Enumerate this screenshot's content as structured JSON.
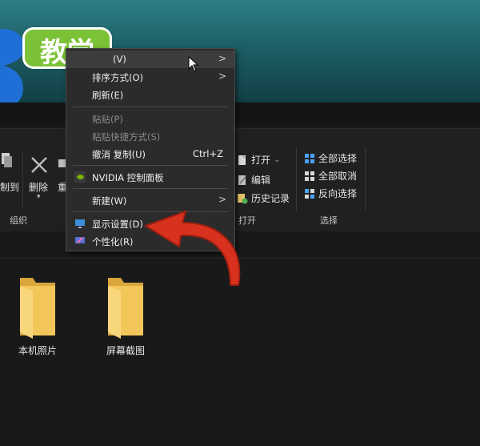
{
  "badge": {
    "text": "教学"
  },
  "context_menu": {
    "items": [
      {
        "label": "(V)",
        "has_submenu": true
      },
      {
        "label": "排序方式(O)",
        "has_submenu": true
      },
      {
        "label": "刷新(E)"
      },
      {
        "label": "粘贴(P)",
        "disabled": true
      },
      {
        "label": "粘贴快捷方式(S)",
        "disabled": true
      },
      {
        "label": "撤消 复制(U)",
        "shortcut": "Ctrl+Z"
      },
      {
        "label": "NVIDIA 控制面板",
        "icon": "nvidia-icon"
      },
      {
        "label": "新建(W)",
        "has_submenu": true
      },
      {
        "label": "显示设置(D)",
        "icon": "display-settings-icon"
      },
      {
        "label": "个性化(R)",
        "icon": "personalize-icon"
      }
    ],
    "chevron": ">"
  },
  "ribbon": {
    "copy_to": "制到",
    "delete": "删除",
    "rename": "重",
    "open": "打开",
    "open_caret": "⌄",
    "edit": "编辑",
    "history": "历史记录",
    "select_all": "全部选择",
    "select_none": "全部取消",
    "invert_selection": "反向选择",
    "group_organize": "组织",
    "group_open": "打开",
    "group_select": "选择"
  },
  "folders": [
    {
      "name": "本机照片"
    },
    {
      "name": "屏幕截图"
    }
  ],
  "colors": {
    "badge": "#7cc237",
    "arrow": "#d8321f",
    "menu_bg": "#2b2b2b",
    "folder": "#f3c65a"
  }
}
